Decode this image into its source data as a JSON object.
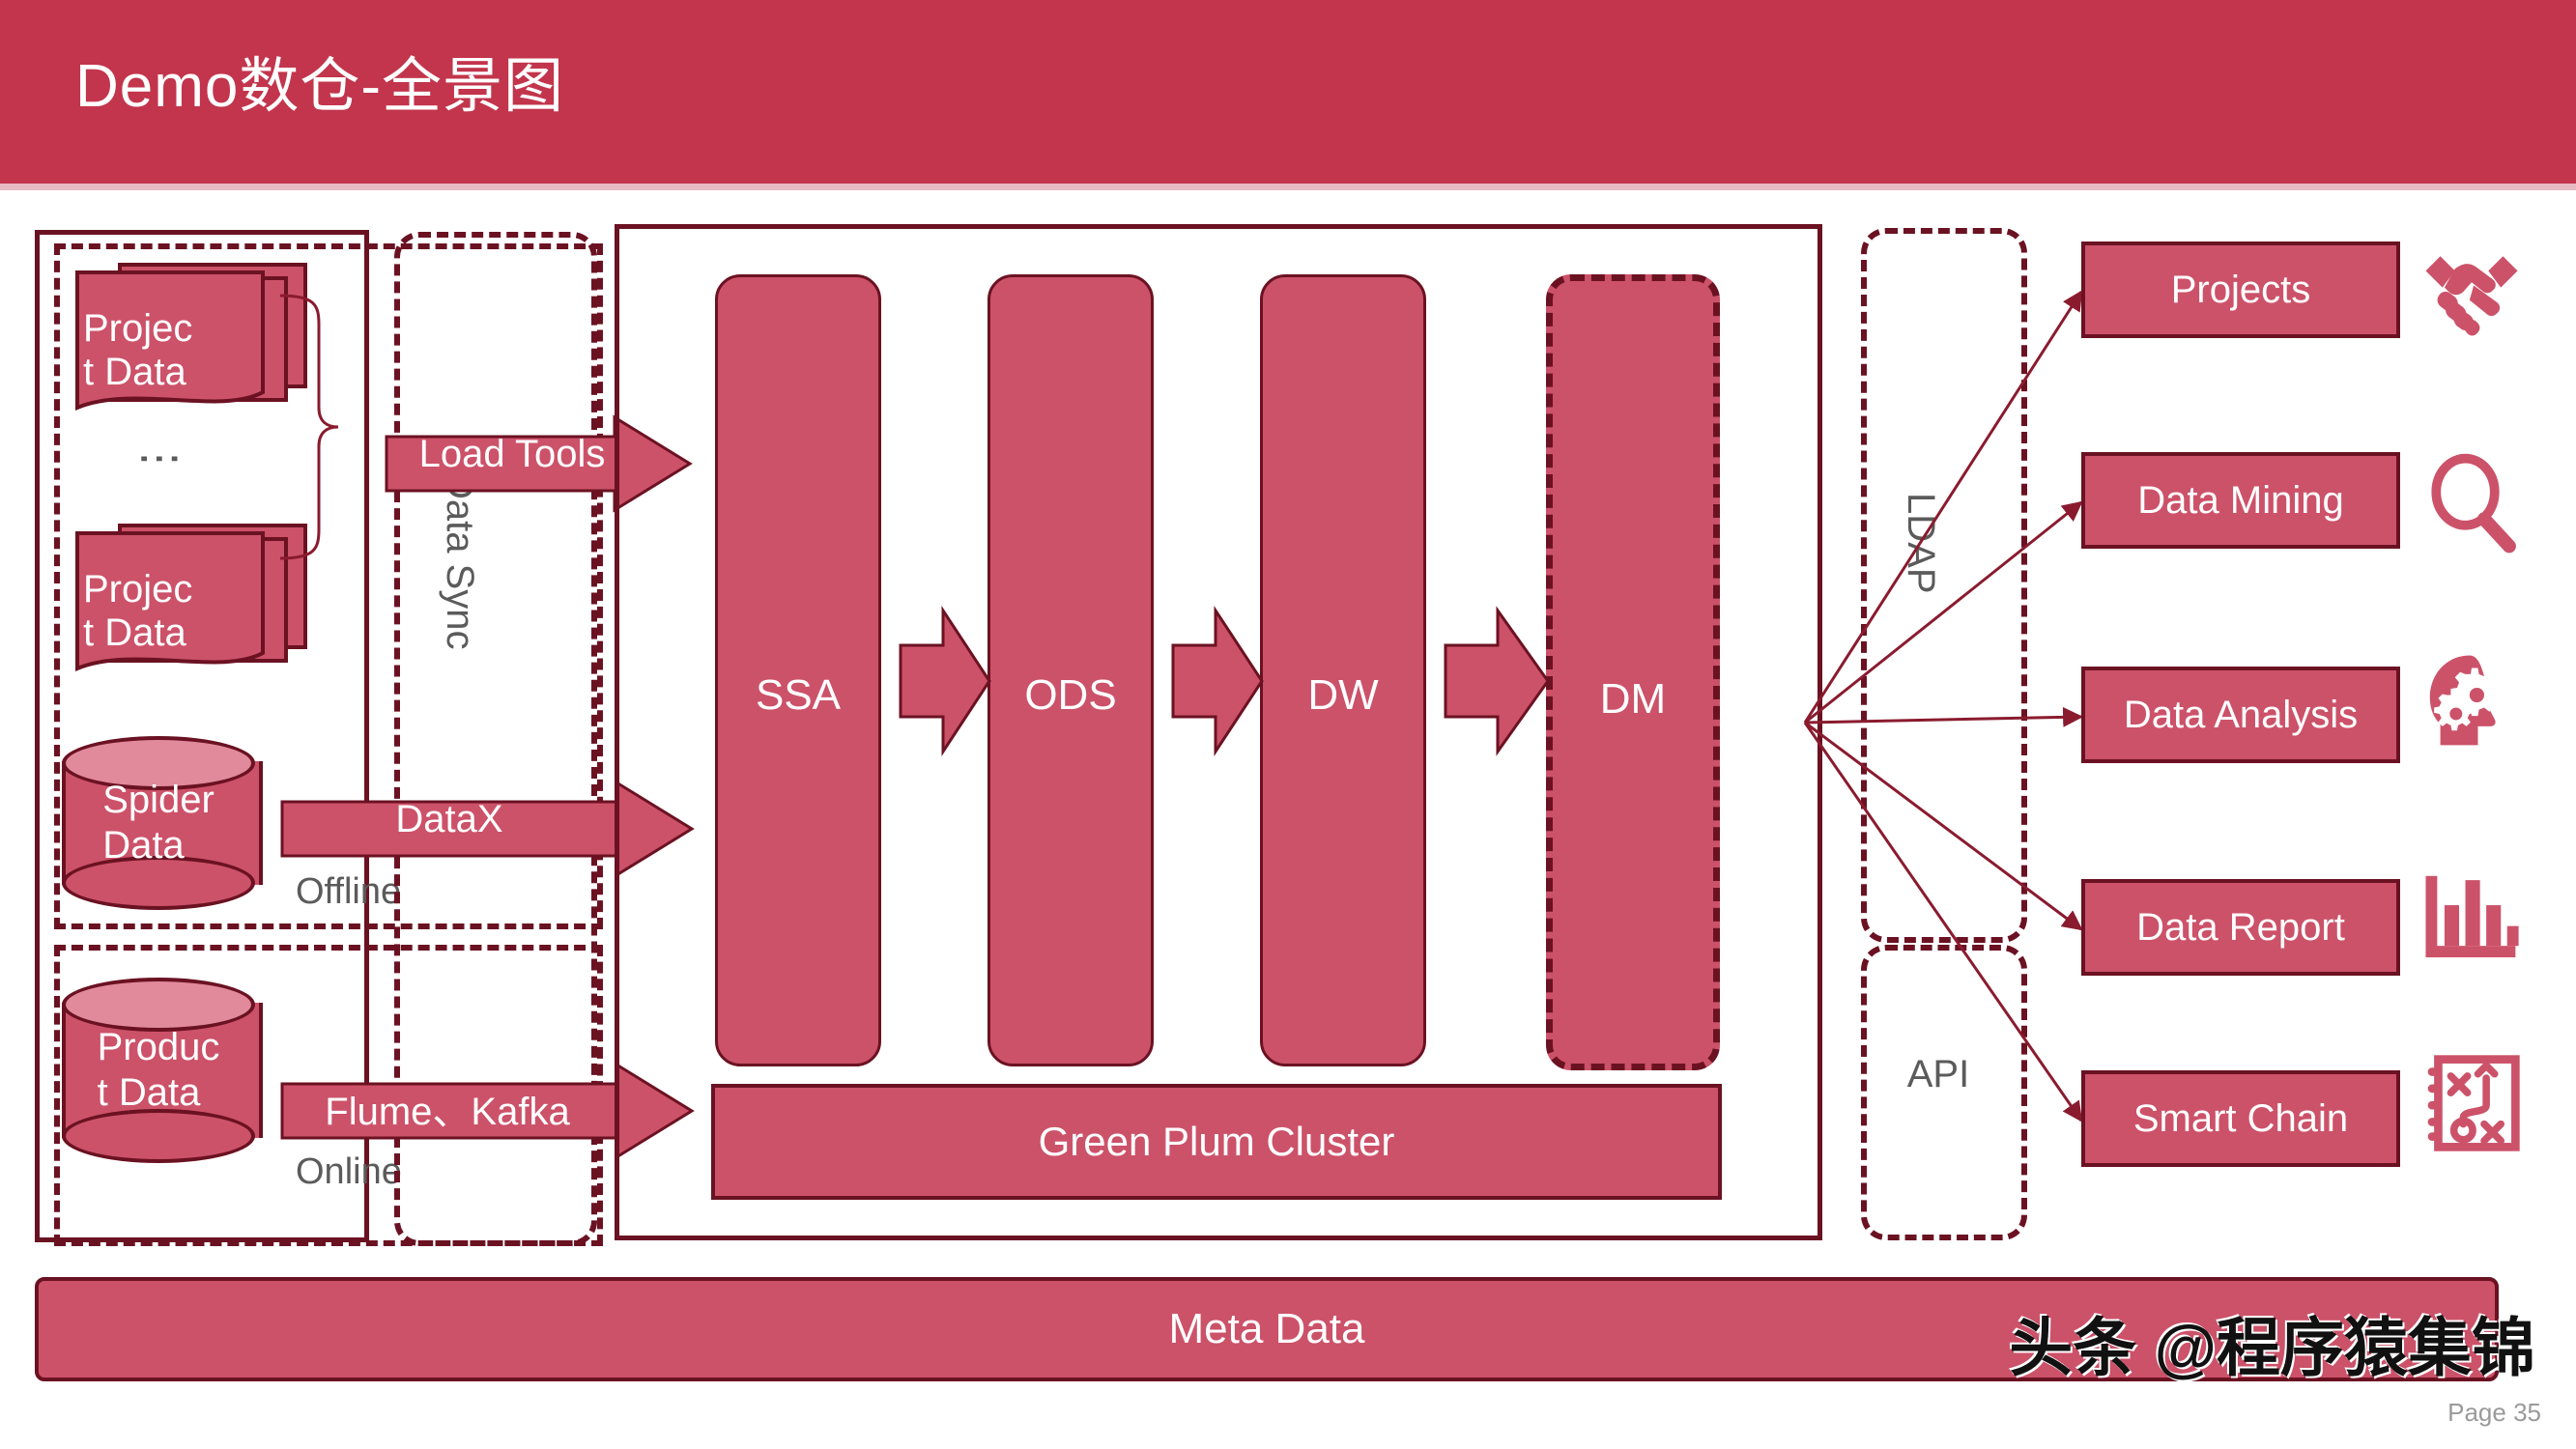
{
  "header": {
    "title": "Demo数仓-全景图"
  },
  "sources": {
    "offline_label": "Offline",
    "online_label": "Online",
    "ellipsis": "⋮",
    "project_data_1": "Projec\nt Data",
    "project_data_2": "Projec\nt Data",
    "spider_data": "Spider\nData",
    "product_data": "Produc\nt Data"
  },
  "sync": {
    "vertical_label": "Data Sync",
    "arrows": [
      {
        "label": "Load Tools"
      },
      {
        "label": "DataX"
      },
      {
        "label": "Flume、Kafka"
      }
    ]
  },
  "warehouse": {
    "pillars": [
      {
        "label": "SSA",
        "dashed": false
      },
      {
        "label": "ODS",
        "dashed": false
      },
      {
        "label": "DW",
        "dashed": false
      },
      {
        "label": "DM",
        "dashed": true
      }
    ],
    "cluster_label": "Green Plum Cluster"
  },
  "access": {
    "ldap_label": "LDAP",
    "api_label": "API"
  },
  "outputs": [
    {
      "label": "Projects",
      "icon": "handshake-icon"
    },
    {
      "label": "Data Mining",
      "icon": "magnifier-icon"
    },
    {
      "label": "Data Analysis",
      "icon": "head-gears-icon"
    },
    {
      "label": "Data Report",
      "icon": "bar-chart-icon"
    },
    {
      "label": "Smart Chain",
      "icon": "strategy-icon"
    }
  ],
  "footer": {
    "meta_data_label": "Meta Data"
  },
  "watermark": {
    "text": "头条 @程序猿集锦",
    "page": "Page 35"
  },
  "colors": {
    "header_bg": "#C2354C",
    "fill": "#CC5269",
    "stroke": "#6B1222",
    "header_underline": "#E8B9C3",
    "gray_text": "#5B5B5B"
  }
}
